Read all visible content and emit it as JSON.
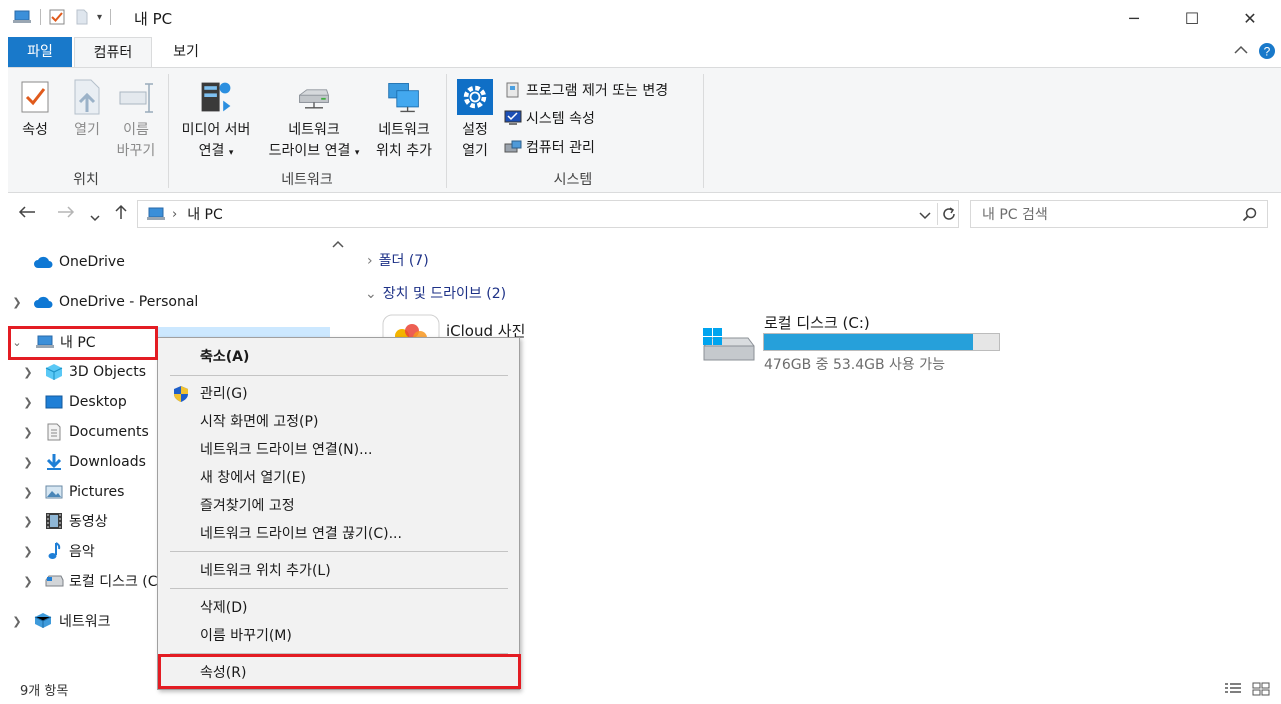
{
  "window": {
    "title": "내 PC",
    "minimize": "─",
    "maximize": "☐",
    "close": "✕"
  },
  "ribbon_tabs": [
    "파일",
    "컴퓨터",
    "보기"
  ],
  "ribbon": {
    "location": {
      "label": "위치",
      "properties": "속성",
      "open": "열기",
      "rename_l1": "이름",
      "rename_l2": "바꾸기"
    },
    "network": {
      "label": "네트워크",
      "media_l1": "미디어 서버",
      "media_l2": "연결",
      "map_l1": "네트워크",
      "map_l2": "드라이브 연결",
      "add_l1": "네트워크",
      "add_l2": "위치 추가"
    },
    "system": {
      "label": "시스템",
      "settings_l1": "설정",
      "settings_l2": "열기",
      "uninstall": "프로그램 제거 또는 변경",
      "sys_props": "시스템 속성",
      "manage": "컴퓨터 관리"
    }
  },
  "address": {
    "path": "내 PC",
    "search_placeholder": "내 PC 검색"
  },
  "nav": {
    "onedrive": "OneDrive",
    "onedrive_personal": "OneDrive - Personal",
    "this_pc": "내 PC",
    "objects3d": "3D Objects",
    "desktop": "Desktop",
    "documents": "Documents",
    "downloads": "Downloads",
    "pictures": "Pictures",
    "videos": "동영상",
    "music": "음악",
    "local_disk": "로컬 디스크 (C:)",
    "network": "네트워크"
  },
  "content": {
    "folders_head": "폴더 (7)",
    "devices_head": "장치 및 드라이브 (2)",
    "icloud": "iCloud 사진",
    "drive_name": "로컬 디스크 (C:)",
    "drive_free": "476GB 중 53.4GB 사용 가능",
    "drive_used_fraction": 0.89
  },
  "context_menu": {
    "collapse": "축소(A)",
    "manage": "관리(G)",
    "pin_start": "시작 화면에 고정(P)",
    "map_drive": "네트워크 드라이브 연결(N)...",
    "open_new": "새 창에서 열기(E)",
    "pin_quick": "즐겨찾기에 고정",
    "disconnect": "네트워크 드라이브 연결 끊기(C)...",
    "add_location": "네트워크 위치 추가(L)",
    "delete": "삭제(D)",
    "rename": "이름 바꾸기(M)",
    "properties": "속성(R)"
  },
  "status": {
    "count": "9개 항목"
  },
  "colors": {
    "accent": "#1979ca",
    "highlight_box": "#e31c23",
    "drive_bar": "#26a0da"
  }
}
